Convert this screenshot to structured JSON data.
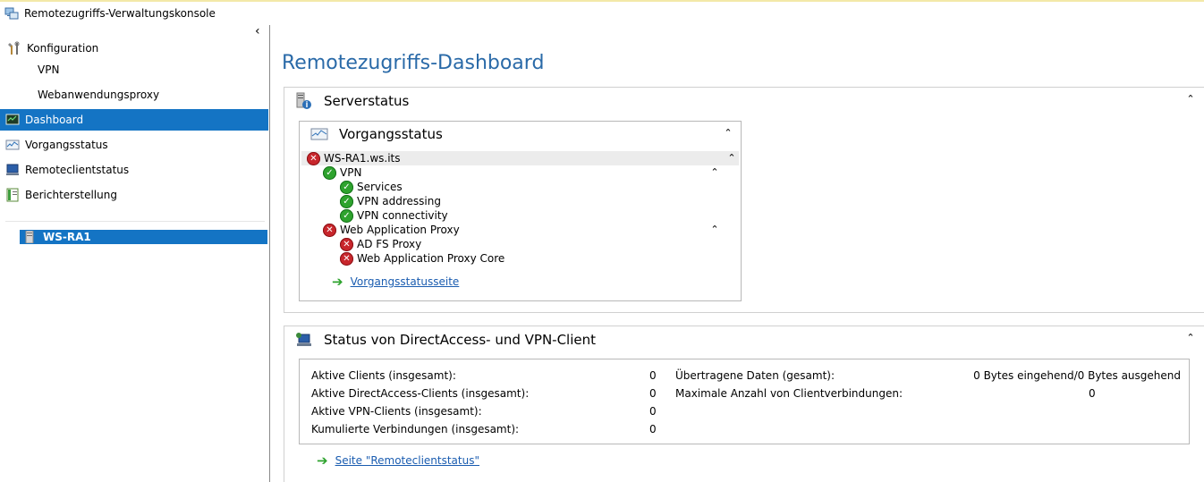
{
  "window": {
    "title": "Remotezugriffs-Verwaltungskonsole"
  },
  "sidebar": {
    "items": [
      {
        "label": "Konfiguration"
      },
      {
        "label": "VPN"
      },
      {
        "label": "Webanwendungsproxy"
      },
      {
        "label": "Dashboard"
      },
      {
        "label": "Vorgangsstatus"
      },
      {
        "label": "Remoteclientstatus"
      },
      {
        "label": "Berichterstellung"
      }
    ],
    "server": "WS-RA1"
  },
  "main": {
    "title": "Remotezugriffs-Dashboard",
    "server_status": {
      "title": "Serverstatus",
      "operations": {
        "title": "Vorgangsstatus",
        "host": "WS-RA1.ws.its",
        "vpn": {
          "label": "VPN",
          "children": [
            "Services",
            "VPN addressing",
            "VPN connectivity"
          ]
        },
        "wap": {
          "label": "Web Application Proxy",
          "children": [
            "AD FS Proxy",
            "Web Application Proxy Core"
          ]
        },
        "link": "Vorgangsstatusseite"
      }
    },
    "client_status": {
      "title": "Status von DirectAccess- und VPN-Client",
      "left": [
        {
          "label": "Aktive Clients (insgesamt):",
          "value": "0"
        },
        {
          "label": "Aktive DirectAccess-Clients (insgesamt):",
          "value": "0"
        },
        {
          "label": "Aktive VPN-Clients (insgesamt):",
          "value": "0"
        },
        {
          "label": "Kumulierte Verbindungen (insgesamt):",
          "value": "0"
        }
      ],
      "right": [
        {
          "label": "Übertragene Daten (gesamt):",
          "value": "0 Bytes eingehend/0 Bytes ausgehend"
        },
        {
          "label": "Maximale Anzahl von Clientverbindungen:",
          "value": "0"
        }
      ],
      "link": "Seite \"Remoteclientstatus\""
    }
  },
  "colors": {
    "selection": "#1474c4",
    "title": "#2a6aa8",
    "error": "#c8262c",
    "ok": "#2ea32e",
    "link": "#1a5cb0"
  }
}
